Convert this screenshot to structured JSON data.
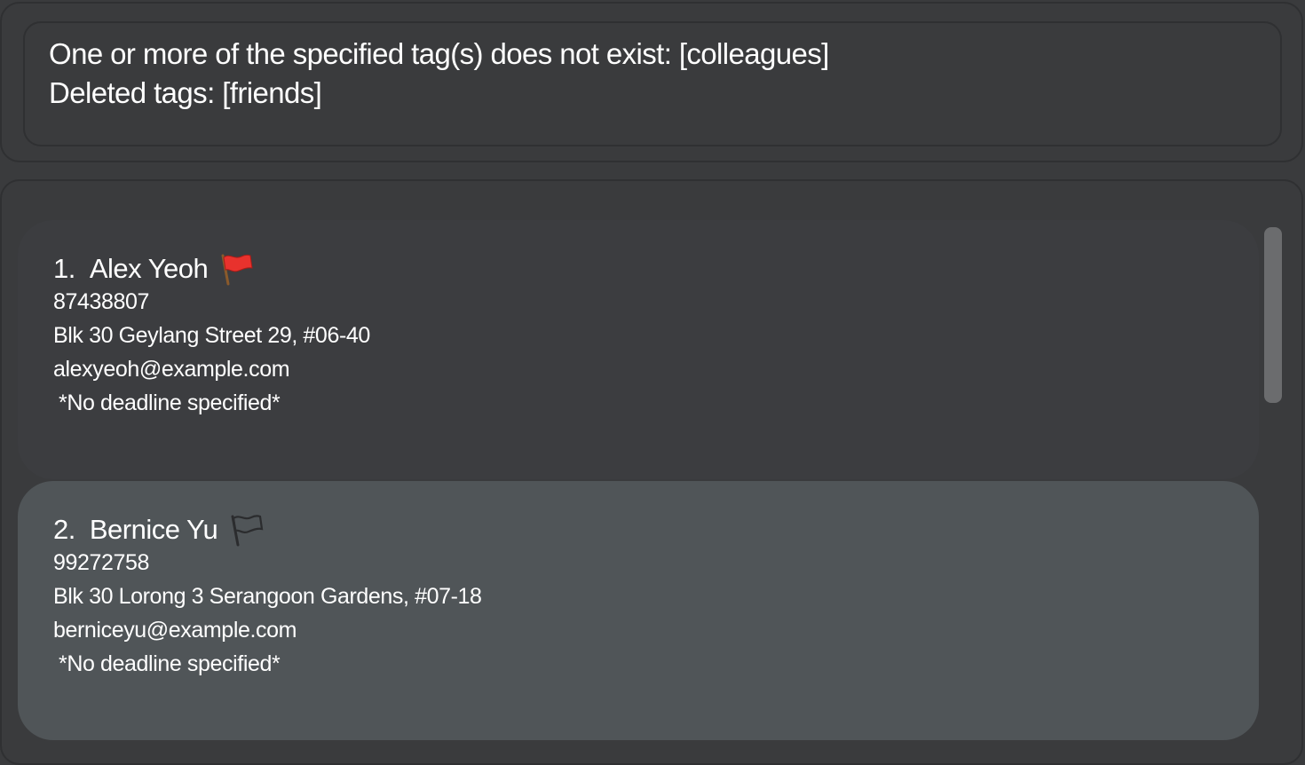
{
  "result_display": {
    "lines": [
      "One or more of the specified tag(s) does not exist: [colleagues]",
      "Deleted tags: [friends]"
    ]
  },
  "person_list": {
    "cards": [
      {
        "index": "1.",
        "name": "Alex Yeoh",
        "flag_icon": "red-flag-icon",
        "flag_color": "#e8322d",
        "phone": "87438807",
        "address": "Blk 30 Geylang Street 29, #06-40",
        "email": "alexyeoh@example.com",
        "deadline": "*No deadline specified*"
      },
      {
        "index": "2.",
        "name": "Bernice Yu",
        "flag_icon": "outline-flag-icon",
        "flag_color": "#2b2c2e",
        "phone": "99272758",
        "address": "Blk 30 Lorong 3 Serangoon Gardens, #07-18",
        "email": "berniceyu@example.com",
        "deadline": "*No deadline specified*"
      }
    ]
  },
  "colors": {
    "background": "#3a3b3d",
    "selected_card": "#505558",
    "border": "#2f3032",
    "text": "#ffffff"
  }
}
